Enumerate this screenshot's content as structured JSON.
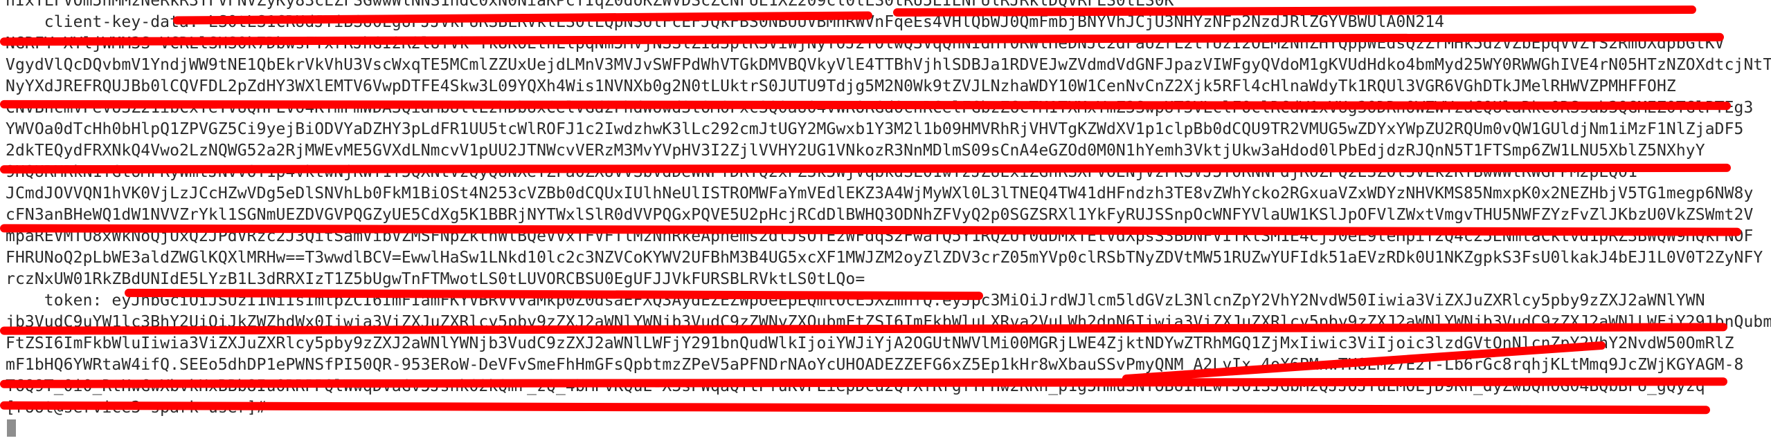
{
  "terminal": {
    "lines": [
      "hIxTLFVOm5hMMzNeRkR3TFVFNVZyKy83cEZFSGwwWlNNS1hdC0xN0NiaKPcYIqZ0doKZWVDScZCNFUE1XZ209cl0tLS0tRU5EIENFUlRJRklDQVRFLS0tLS0K",
      "    client-key-data: LS0tLS1CRUdJTiBSU0EgUFJJVkFURSBLRVktLS0tLQpNSUlFcEFJQkFBS0NBUUVBMnRWVnFqeEs4VHlQbWJ0QmFmbjBNYVhJCjU3NHYzNFp2NzdJRlZGYVBWUlA0N214",
      "NGRFY XYljWMM3S VCRLlSHS0k7DbwsFYxrRJhGI2R2lUTVk Tk8KOEtnLlpqNm5MVjNSSlZIa3plR3ViWjNyY0J2T0lwQ3VqQnNIdHY0RWlHeDNJc2dFaUZrL2tTUzI2OEM2NnZHYQppWEdsQzZrMHk5dzVZbEpqVVZYS2RmUXdpbGtKV",
      "VgydVlQcDQvbmV1YndjWW9tNE1QbEkrVkVhU3VscWxqTE5MCmlZZUxUejdLMnV3MVJvSWFPdWhVTGkDMVBQVkyVlE4TTBhVjhlSDBJa1RDVEJwZVdmdVdGNFJpazVIWFgyQVdoM1gKVUdHdko4bmMyd25WY0RWWGhIVE4rN05HTzNZOXdtcjNtTU",
      "NyYXdJREFRQUJBb0lCQVFDL2pZdHY3WXlEMTV6VwpDTFE4Skw3L09YQXh4Wis1NVNXb0g2N0tLUktrS0JUTU9Tdjg5M2N0Wk9tZVJLNzhaWDY10W1CenNvCnZ2Xjk5RFl4cHlnaWdyTk1RQUl3VGR6VGhDTkJMelRHWVZPMHFFOHZ",
      "CNVBncmVFeVo3Z21ibCxTeTVUQHFLV04KYmFmWDA3QidMbUllLzhDbUxCelVGd2FhdWowd3tOM0Fxc3Q0aU04VWRORGdOcnRCelFGbzZ6cTM1TXMxYmZ3SwpUT3VLclFOclRCdW1xVUg3ODRnOWZWYzdCQUlaRkc0RSsab3QGMEZ0TGlPTEg3",
      "YWVOa0dTcHh0bHlpQ1ZPVGZ5Ci9yejBiODVYaDZHY3pLdFR1UU5tcWlROFJ1c2IwdzhwK3lLc292cmJtUGY2MGwxb1Y3M2l1b09HMVRhRjVHVTgKZWdXV1p1clpBb0dCQU9TR2VMUG5wZDYxYWpZU2RQUm0vQW1GUldjNm1iMzF1NlZjaDF5",
      "2dkTEQydFRXNkQ4Vwo2LzNQWG52a2RjMWEvME5GVXdLNmcvV1pUU2JTNWcvVERzM3MvYVpHV3I2ZjlVVHY2UG1VNkozR3NnMDlmS09sCnA4eGZOd0M0N1hYemh3VktjUkw3aHdod0lPbEdjdzRJQnN5T1FTSmp6ZW1LNU5XblZ5NXhyY",
      "9HQURMRkN1TGtoMFRyWmtJNVVOY1p4VktwNjRWY1Y5QXNtVzQyQUNXeTZFa0ZXUVVSbVdDeWNPTDRYQ2xPZ3k5WjVqbkdSL01wTzJZUExiZGhRSXFVOENjVzFRSVJ5T0RNNFdjR0ZPQ2E3Z0l5VEk2RTBwWWtRWGFPM2pLQ01",
      "JCmdJOVVQN1hVK0VjLzJCcHZwVDg5eDlSNVhLb0FkM1BiOSt4N253cVZBb0dCQUxIUlhNeUlISTROMWFaYmVEdlEKZ3A4WjMyWXl0L3lTNEQ4TW41dHFndzh3TE8vZWhYcko2RGxuaVZxWDYzNHVKMS85NmxpK0x2NEZHbjV5TG1megp6NW8y",
      "cFN3anBHeWQ1dW1NVVZrYkl1SGNmUEZDVGVPQGZyUE5CdXg5K1BBRjNYTWxlSlR0dVVPQGxPQVE5U2pHcjRCdDlBWHQ3ODNhZFVyQ2p0SGZSRXl1YkFyRUJSSnpOcWNFYVlaUW1KSlJpOFVlZWxtVmgvTHU5NWFZYzFvZlJKbzU0VkZSWmt2V",
      "mpaREVMTU8xWkNoQjUxQ2JPdVRzc2J3QitSamVibVZMSFNpZkthWlBQeVVxTFVFTlMzNnRkeAphems2dlJsOTEzWFdqS2FwaTQ5Y1RQZUY0dDMxTEtVdXpsS3BDNFVITklSM1E4cjJ0eE9teHpiT2Q4c25ENmtaCktvd1pRZ3BWQW9HQkFNOF",
      "FHRUNoQ2pLbWE3aldZWGlKQXlMRHw==T3wwdlBCV=EwwlHaSw1LNkd10lc2c3NZVCoKYWV2UFBhM3B4UG5xcXF1MWJZM2oyZlZDV3crZ05mYVp0clRSbTNyZDVtMW51RUZwYUFIdk51aEVzRDk0U1NKZgpkS3FsU0lkakJ4bEJ1L0V0T2ZyNFY",
      "rczNxUW01RkZBdUNIdE5LYzB1L3dRRXIzT1Z5bUgwTnFTMwotLS0tLUVORCBSU0EgUFJJVkFURSBLRVktLS0tLQo=",
      "    token: eyJhbGciOiJSUzI1NiIsImtpZCI6ImFIamFKYVBRVVVaMkp0Z0dsaEFXQ3AydEZEZWpUeEpEQmlOcE5XZmhfQ.eyJpc3MiOiJrdWJlcm5ldGVzL3NlcnZpY2VhY2NvdW50Iiwia3ViZXJuZXRlcy5pby9zZXJ2aWNlYWN",
      "jb3VudC9uYW1lc3BhY2UiOiJkZWZhdWx0Iiwia3ViZXJuZXRlcy5pby9zZXJ2aWNlYWNjb3VudC9zZWNyZXQubmFtZSI6ImFkbWluLXRva2VuLWh2dnN6Iiwia3ViZXJuZXRlcy5pby9zZXJ2aWNlYWNjb3VudC9zZXJ2aWNlLWFjY291bnQubm",
      "FtZSI6ImFkbWluIiwia3ViZXJuZXRlcy5pby9zZXJ2aWNlYWNjb3VudC9zZXJ2aWNlLWFjY291bnQudWlkIjoiYWJiYjA2OGUtNWVlMi00MGRjLWE4ZjktNDYwZTRhMGQ1ZjMxIiwic3ViIjoic3lzdGVtOnNlcnZpY2VhY2NvdW50OmRlZ",
      "mF1bHQ6YWRtaW4ifQ.SEEo5dhDP1ePWNSfPI50QR-953ERoW-DeVFvSmeFhHmGFsQpbtmzZPeV5aPFNDrNAoYcUHOADEZZEFG6xZ5Ep1kHr8wXbauSSvPmyQNM_A2LyIx_4oX6PMnwTH8EMz7E2T-Lb6rGc8rqhjKLtMmq9JcZWjKGYAGM-8",
      "T6Q9T_0i0_RtHwGwXbvkHxBBb8Iu0RRPPQlWwqDVaGv5Jsnk02kQmr_zQ_4bMPvKQuE-X3sPWqaQYtPfuKvPEiepDcu2QfXfRrgfYPHw2RRh_p1g5HmuSNYoBUIMEwYJO1SJGbMzQJJOJYuEMOEjD9Rn_dyZwbQnOG04BQbBFo_gQyzq",
      "[root@service3 spark-user]# "
    ]
  },
  "colors": {
    "background": "#ffffff",
    "text": "#2b2b2b",
    "redaction": "#ff0000",
    "cursor": "#8e8e8e"
  }
}
